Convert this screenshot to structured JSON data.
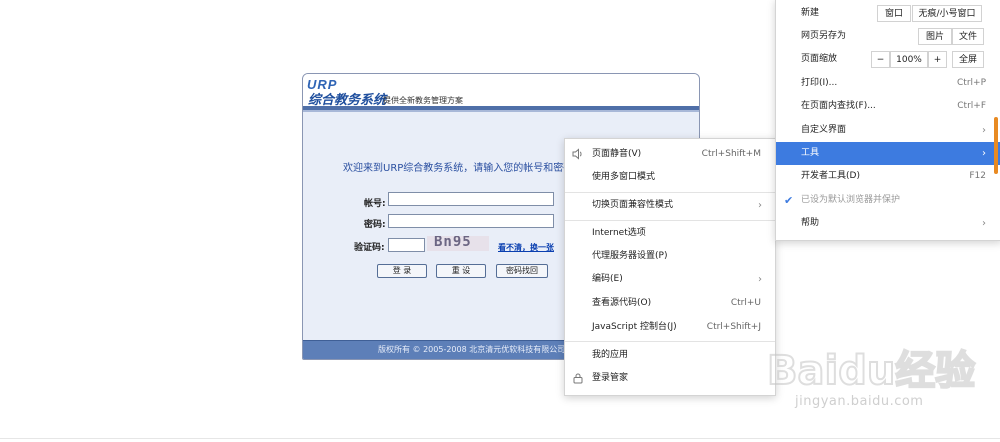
{
  "login": {
    "urp_logo": "URP",
    "system_name": "综合教务系统",
    "slogan": "提供全新教务管理方案",
    "welcome": "欢迎来到URP综合教务系统，请输入您的帐号和密码",
    "account_label": "帐号:",
    "password_label": "密码:",
    "captcha_label": "验证码:",
    "captcha_text": "Bn95",
    "refresh_link": "看不清，换一张",
    "login_button": "登 录",
    "reset_button": "重 设",
    "recover_button": "密码找回",
    "copyright": "版权所有 © 2005-2008 北京清元优软科技有限公司"
  },
  "context_menu": {
    "items": [
      {
        "label": "页面静音(V)",
        "shortcut": "Ctrl+Shift+M",
        "icon": "speaker-icon"
      },
      {
        "label": "使用多窗口模式"
      },
      {
        "label": "切换页面兼容性模式",
        "submenu": "›"
      },
      {
        "label": "Internet选项"
      },
      {
        "label": "代理服务器设置(P)"
      },
      {
        "label": "编码(E)",
        "submenu": "›"
      },
      {
        "label": "查看源代码(O)",
        "shortcut": "Ctrl+U"
      },
      {
        "label": "JavaScript 控制台(J)",
        "shortcut": "Ctrl+Shift+J"
      },
      {
        "label": "我的应用"
      },
      {
        "label": "登录管家",
        "icon": "lock-icon"
      }
    ]
  },
  "main_menu": {
    "new_label": "新建",
    "new_window": "窗口",
    "new_incognito": "无痕/小号窗口",
    "save_as_label": "网页另存为",
    "save_image": "图片",
    "save_file": "文件",
    "zoom_label": "页面缩放",
    "zoom_minus": "−",
    "zoom_value": "100%",
    "zoom_plus": "+",
    "fullscreen": "全屏",
    "items": [
      {
        "label": "打印(I)...",
        "shortcut": "Ctrl+P"
      },
      {
        "label": "在页面内查找(F)...",
        "shortcut": "Ctrl+F"
      },
      {
        "label": "自定义界面",
        "submenu": "›"
      },
      {
        "label": "工具",
        "submenu": "›"
      },
      {
        "label": "开发者工具(D)",
        "shortcut": "F12"
      },
      {
        "label": "已设为默认浏览器并保护",
        "check": "✔"
      },
      {
        "label": "帮助",
        "submenu": "›"
      }
    ],
    "active_color": "#3d7be0"
  },
  "watermark": {
    "logo": "Baidu经验",
    "url": "jingyan.baidu.com"
  }
}
